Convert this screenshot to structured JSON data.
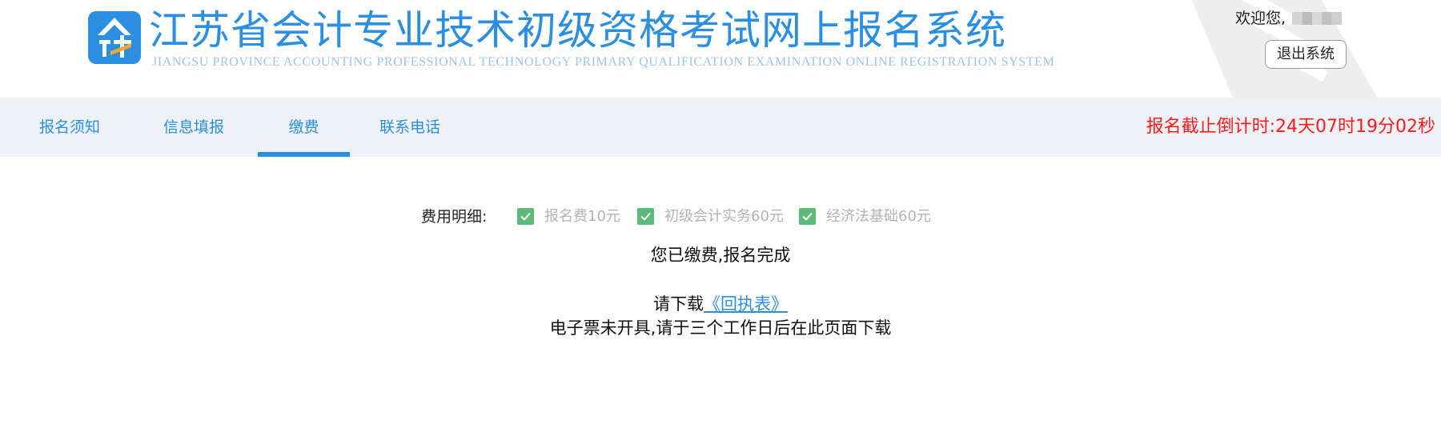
{
  "header": {
    "title": "江苏省会计专业技术初级资格考试网上报名系统",
    "subtitle": "JIANGSU PROVINCE ACCOUNTING PROFESSIONAL TECHNOLOGY PRIMARY QUALIFICATION EXAMINATION ONLINE REGISTRATION SYSTEM",
    "welcome_label": "欢迎您,",
    "logout_label": "退出系统"
  },
  "nav": {
    "tabs": [
      {
        "label": "报名须知",
        "active": false
      },
      {
        "label": "信息填报",
        "active": false
      },
      {
        "label": "缴费",
        "active": true
      },
      {
        "label": "联系电话",
        "active": false
      }
    ],
    "countdown": "报名截止倒计时:24天07时19分02秒"
  },
  "fees": {
    "label": "费用明细:",
    "items": [
      {
        "label": "报名费10元",
        "checked": true
      },
      {
        "label": "初级会计实务60元",
        "checked": true
      },
      {
        "label": "经济法基础60元",
        "checked": true
      }
    ]
  },
  "status": {
    "paid_message": "您已缴费,报名完成",
    "download_prefix": "请下载",
    "download_link": "《回执表》",
    "invoice_notice": "电子票未开具,请于三个工作日后在此页面下载"
  },
  "colors": {
    "brand_blue": "#2a8fe0",
    "nav_bg": "#eef2f6",
    "countdown_red": "#ff1a1a",
    "checkbox_green": "#5bb97a"
  }
}
